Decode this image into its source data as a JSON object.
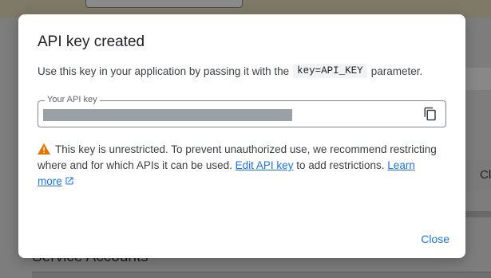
{
  "background": {
    "section_title": "Service Accounts",
    "right_column_text": "Cl"
  },
  "dialog": {
    "title": "API key created",
    "description_prefix": "Use this key in your application by passing it with the",
    "description_code": "key=API_KEY",
    "description_suffix": "parameter.",
    "key_field": {
      "label": "Your API key",
      "copy_icon": "copy-icon"
    },
    "warning": {
      "icon": "warning-icon",
      "text_1": "This key is unrestricted. To prevent unauthorized use, we recommend restricting where and for which APIs it can be used.",
      "edit_link": "Edit API key",
      "text_2": "to add restrictions.",
      "learn_more_link": "Learn more",
      "learn_more_icon": "external-link-icon"
    },
    "close_label": "Close"
  },
  "colors": {
    "accent": "#1a73e8",
    "warning": "#e37400",
    "scrim": "#7d7d7d"
  }
}
